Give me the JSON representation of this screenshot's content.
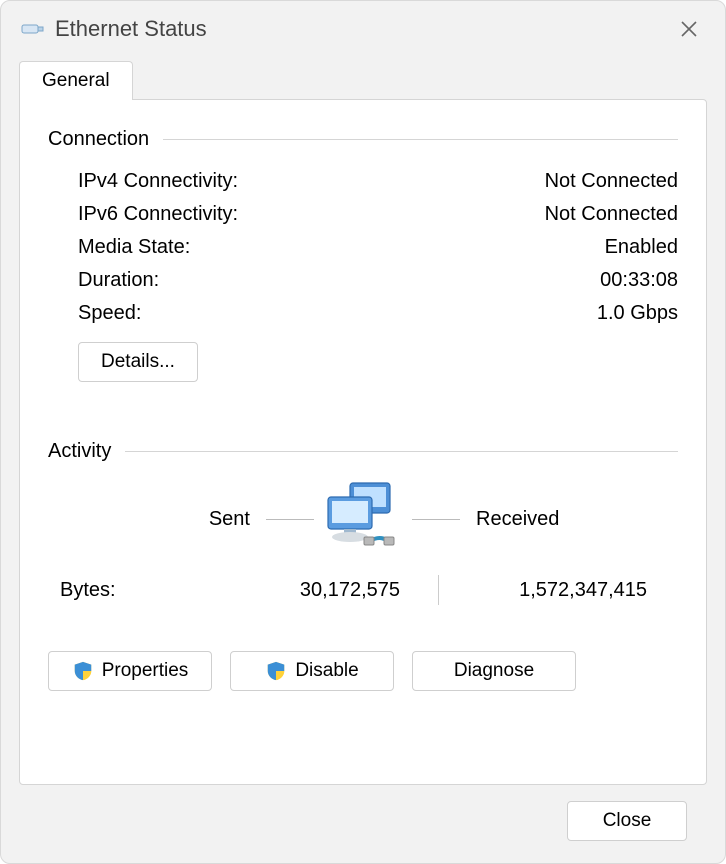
{
  "window": {
    "title": "Ethernet Status"
  },
  "tabs": {
    "general": "General"
  },
  "connection": {
    "header": "Connection",
    "rows": {
      "ipv4": {
        "label": "IPv4 Connectivity:",
        "value": "Not Connected"
      },
      "ipv6": {
        "label": "IPv6 Connectivity:",
        "value": "Not Connected"
      },
      "media": {
        "label": "Media State:",
        "value": "Enabled"
      },
      "duration": {
        "label": "Duration:",
        "value": "00:33:08"
      },
      "speed": {
        "label": "Speed:",
        "value": "1.0 Gbps"
      }
    },
    "details_button": "Details..."
  },
  "activity": {
    "header": "Activity",
    "sent_label": "Sent",
    "received_label": "Received",
    "bytes_label": "Bytes:",
    "bytes_sent": "30,172,575",
    "bytes_received": "1,572,347,415"
  },
  "buttons": {
    "properties": "Properties",
    "disable": "Disable",
    "diagnose": "Diagnose",
    "close": "Close"
  }
}
